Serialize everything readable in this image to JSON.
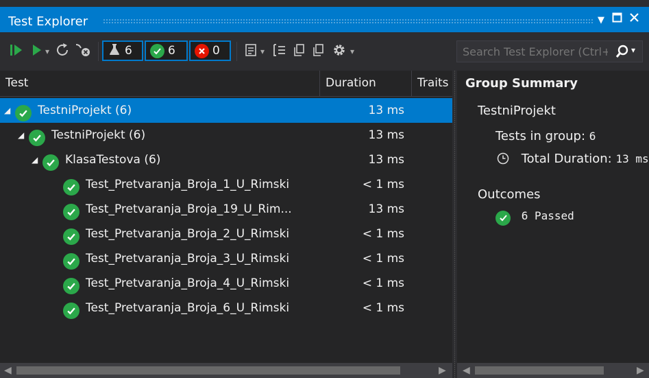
{
  "window": {
    "title": "Test Explorer"
  },
  "toolbar": {
    "all_count": "6",
    "passed_count": "6",
    "failed_count": "0",
    "search_placeholder": "Search Test Explorer (Ctrl+E)"
  },
  "columns": {
    "test": "Test",
    "duration": "Duration",
    "traits": "Traits"
  },
  "tree": [
    {
      "name": "TestniProjekt (6)",
      "duration": "13 ms",
      "level": 0,
      "expander": true,
      "selected": true
    },
    {
      "name": "TestniProjekt (6)",
      "duration": "13 ms",
      "level": 1,
      "expander": true,
      "selected": false
    },
    {
      "name": "KlasaTestova (6)",
      "duration": "13 ms",
      "level": 2,
      "expander": true,
      "selected": false
    },
    {
      "name": "Test_Pretvaranja_Broja_1_U_Rimski",
      "duration": "< 1 ms",
      "level": 3,
      "expander": false,
      "selected": false
    },
    {
      "name": "Test_Pretvaranja_Broja_19_U_Rim...",
      "duration": "13 ms",
      "level": 3,
      "expander": false,
      "selected": false
    },
    {
      "name": "Test_Pretvaranja_Broja_2_U_Rimski",
      "duration": "< 1 ms",
      "level": 3,
      "expander": false,
      "selected": false
    },
    {
      "name": "Test_Pretvaranja_Broja_3_U_Rimski",
      "duration": "< 1 ms",
      "level": 3,
      "expander": false,
      "selected": false
    },
    {
      "name": "Test_Pretvaranja_Broja_4_U_Rimski",
      "duration": "< 1 ms",
      "level": 3,
      "expander": false,
      "selected": false
    },
    {
      "name": "Test_Pretvaranja_Broja_6_U_Rimski",
      "duration": "< 1 ms",
      "level": 3,
      "expander": false,
      "selected": false
    }
  ],
  "summary": {
    "heading": "Group Summary",
    "group_name": "TestniProjekt",
    "tests_in_group_label": "Tests in group:",
    "tests_in_group_value": "6",
    "total_duration_label": "Total Duration:",
    "total_duration_value": "13 ms",
    "outcomes_label": "Outcomes",
    "passed_text": "6 Passed"
  },
  "colors": {
    "accent": "#007acc",
    "pass": "#2ba84a",
    "fail": "#e51400",
    "background": "#252526"
  },
  "icons": [
    "run-all-icon",
    "run-icon",
    "refresh-icon",
    "cancel-icon",
    "flask-icon",
    "check-circle-icon",
    "error-circle-icon",
    "playlist-icon",
    "group-by-icon",
    "copy-icon",
    "settings-icon",
    "search-icon",
    "clock-icon"
  ]
}
